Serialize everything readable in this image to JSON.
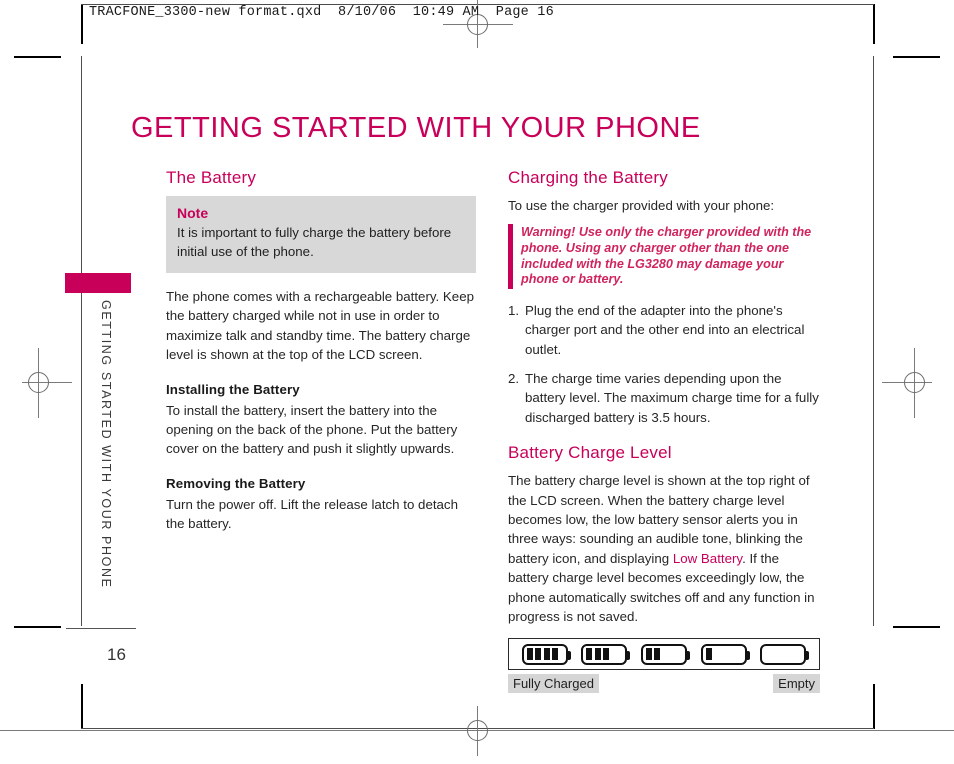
{
  "slug": "TRACFONE_3300-new format.qxd  8/10/06  10:49 AM  Page 16",
  "page": {
    "title": "GETTING STARTED WITH YOUR PHONE",
    "number": "16",
    "running_head": "GETTING STARTED WITH YOUR PHONE",
    "accent_color": "#c8005a"
  },
  "left_column": {
    "section_title": "The Battery",
    "note": {
      "title": "Note",
      "body": "It is important to fully charge the battery before initial use of the phone."
    },
    "intro": "The phone comes with a rechargeable battery. Keep the battery charged while not in use in order to maximize talk and standby time. The battery charge level is shown at the top of the LCD screen.",
    "installing": {
      "heading": "Installing the Battery",
      "body": "To install the battery, insert the battery into the opening on the back of the phone. Put the battery cover on the battery and push it slightly upwards."
    },
    "removing": {
      "heading": "Removing the Battery",
      "body": "Turn the power off. Lift the release latch to detach the battery."
    }
  },
  "right_column": {
    "charging": {
      "section_title": "Charging the Battery",
      "intro": "To use the charger provided with your phone:",
      "warning": "Warning! Use only the charger provided with the phone. Using any charger other than the one included with the LG3280 may damage your phone or battery.",
      "steps": [
        {
          "num": "1.",
          "text": "Plug the end of the adapter into the phone's charger port and the other end into an electrical outlet."
        },
        {
          "num": "2.",
          "text": "The charge time varies depending upon the battery level. The maximum charge time for a fully discharged battery is 3.5 hours."
        }
      ]
    },
    "charge_level": {
      "section_title": "Battery Charge Level",
      "body_part1": "The battery charge level is shown at the top right of the LCD screen. When the battery charge level becomes low, the low battery sensor alerts you in three ways: sounding an audible tone, blinking the battery icon, and displaying ",
      "highlight": "Low Battery",
      "body_part2": ". If the battery charge level becomes exceedingly low, the phone automatically switches off and any function in progress is not saved.",
      "diagram": {
        "bars": [
          4,
          3,
          2,
          1,
          0
        ],
        "label_left": "Fully Charged",
        "label_right": "Empty"
      }
    }
  }
}
